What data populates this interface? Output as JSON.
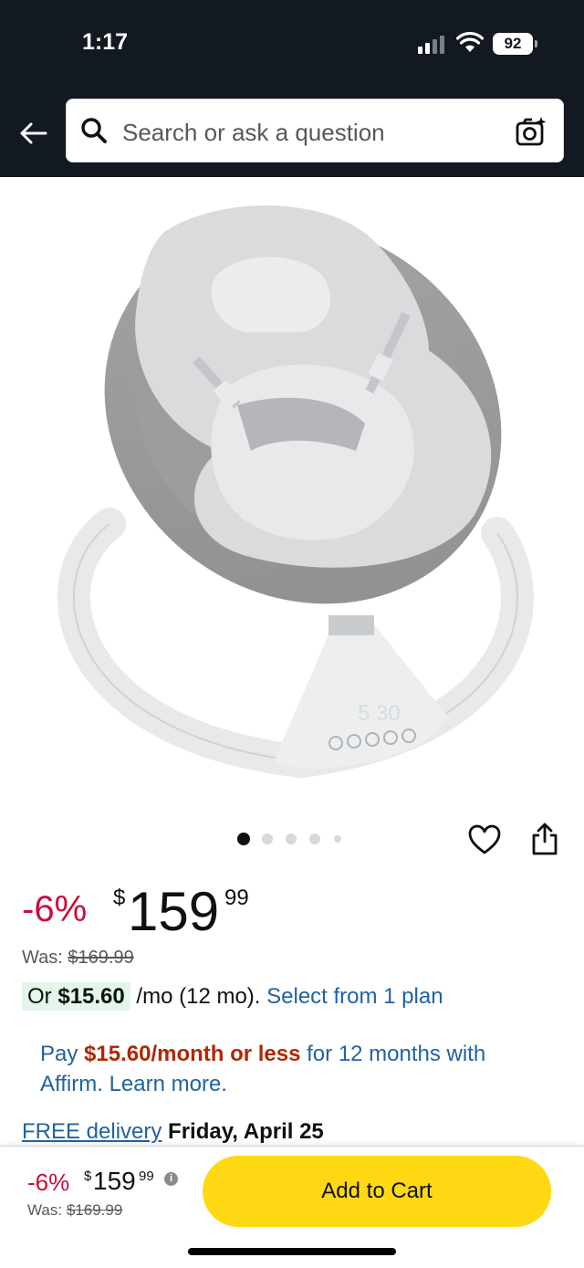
{
  "status_bar": {
    "time": "1:17",
    "battery": "92"
  },
  "search": {
    "placeholder": "Search or ask a question"
  },
  "gallery": {
    "dot_count": 5,
    "active_index": 0,
    "display_text": "530"
  },
  "price": {
    "discount": "-6%",
    "currency": "$",
    "whole": "159",
    "fraction": "99",
    "was_label": "Was:",
    "was_price": "$169.99"
  },
  "monthly": {
    "prefix": "Or",
    "amount": "$15.60",
    "suffix": "/mo (12 mo).",
    "select_link": "Select from 1 plan"
  },
  "affirm": {
    "pay": "Pay",
    "amount": "$15.60/month or less",
    "rest": "for 12 months with Affirm. Learn more."
  },
  "delivery": {
    "free_link": "FREE delivery",
    "date": "Friday, April 25"
  },
  "bottom_bar": {
    "discount": "-6%",
    "currency": "$",
    "whole": "159",
    "fraction": "99",
    "info_icon": "i",
    "was_label": "Was:",
    "was_price": "$169.99",
    "cart_label": "Add to Cart"
  },
  "colors": {
    "header_bg": "#131921",
    "deal_red": "#cc0c39",
    "affirm_red": "#b12704",
    "link_blue": "#2162a1",
    "cart_yellow": "#ffd814",
    "badge_green": "#e3f6e7"
  },
  "icons": [
    "back-arrow-icon",
    "search-icon",
    "camera-search-icon",
    "heart-icon",
    "share-icon",
    "info-icon",
    "signal-icon",
    "wifi-icon"
  ]
}
